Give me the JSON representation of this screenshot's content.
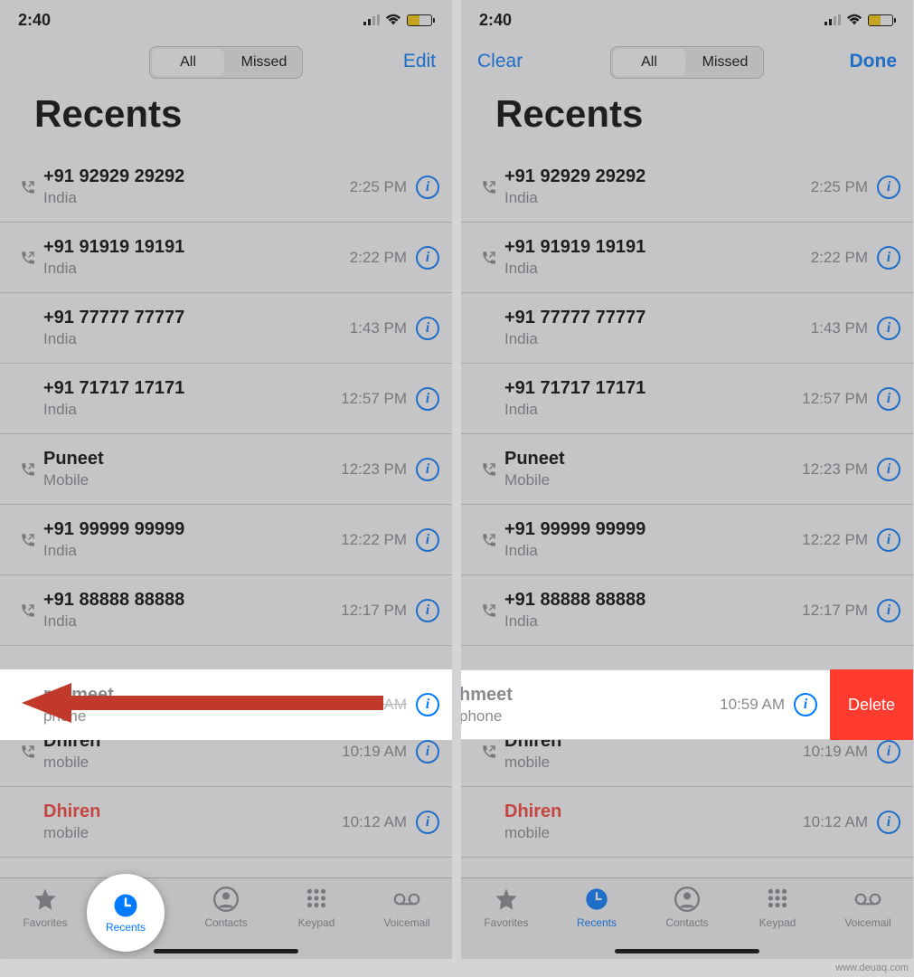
{
  "status": {
    "time": "2:40"
  },
  "left": {
    "nav": {
      "edit": "Edit",
      "seg_all": "All",
      "seg_missed": "Missed"
    },
    "title": "Recents",
    "calls": [
      {
        "name": "+91 92929 29292",
        "sub": "India",
        "time": "2:25 PM",
        "outgoing": true,
        "missed": false
      },
      {
        "name": "+91 91919 19191",
        "sub": "India",
        "time": "2:22 PM",
        "outgoing": true,
        "missed": false
      },
      {
        "name": "+91 77777 77777",
        "sub": "India",
        "time": "1:43 PM",
        "outgoing": false,
        "missed": false
      },
      {
        "name": "+91 71717 17171",
        "sub": "India",
        "time": "12:57 PM",
        "outgoing": false,
        "missed": false
      },
      {
        "name": "Puneet",
        "sub": "Mobile",
        "time": "12:23 PM",
        "outgoing": true,
        "missed": false
      },
      {
        "name": "+91 99999 99999",
        "sub": "India",
        "time": "12:22 PM",
        "outgoing": true,
        "missed": false
      },
      {
        "name": "+91 88888 88888",
        "sub": "India",
        "time": "12:17 PM",
        "outgoing": true,
        "missed": false
      },
      {
        "name": "rshmeet",
        "sub": "phone",
        "time": "10:59 AM",
        "outgoing": false,
        "missed": false
      },
      {
        "name": "Dhiren",
        "sub": "mobile",
        "time": "10:19 AM",
        "outgoing": true,
        "missed": false
      },
      {
        "name": "Dhiren",
        "sub": "mobile",
        "time": "10:12 AM",
        "outgoing": false,
        "missed": true
      }
    ],
    "tabs": {
      "favorites": "Favorites",
      "recents": "Recents",
      "contacts": "Contacts",
      "keypad": "Keypad",
      "voicemail": "Voicemail"
    }
  },
  "right": {
    "nav": {
      "clear": "Clear",
      "done": "Done",
      "seg_all": "All",
      "seg_missed": "Missed"
    },
    "title": "Recents",
    "swipe": {
      "name": "hmeet",
      "sub": "phone",
      "time": "10:59 AM",
      "delete": "Delete"
    },
    "calls": [
      {
        "name": "+91 92929 29292",
        "sub": "India",
        "time": "2:25 PM",
        "outgoing": true,
        "missed": false
      },
      {
        "name": "+91 91919 19191",
        "sub": "India",
        "time": "2:22 PM",
        "outgoing": true,
        "missed": false
      },
      {
        "name": "+91 77777 77777",
        "sub": "India",
        "time": "1:43 PM",
        "outgoing": false,
        "missed": false
      },
      {
        "name": "+91 71717 17171",
        "sub": "India",
        "time": "12:57 PM",
        "outgoing": false,
        "missed": false
      },
      {
        "name": "Puneet",
        "sub": "Mobile",
        "time": "12:23 PM",
        "outgoing": true,
        "missed": false
      },
      {
        "name": "+91 99999 99999",
        "sub": "India",
        "time": "12:22 PM",
        "outgoing": true,
        "missed": false
      },
      {
        "name": "+91 88888 88888",
        "sub": "India",
        "time": "12:17 PM",
        "outgoing": true,
        "missed": false
      },
      {
        "name": "Dhiren",
        "sub": "mobile",
        "time": "10:19 AM",
        "outgoing": true,
        "missed": false
      },
      {
        "name": "Dhiren",
        "sub": "mobile",
        "time": "10:12 AM",
        "outgoing": false,
        "missed": true
      }
    ],
    "tabs": {
      "favorites": "Favorites",
      "recents": "Recents",
      "contacts": "Contacts",
      "keypad": "Keypad",
      "voicemail": "Voicemail"
    }
  },
  "watermark": "www.deuaq.com"
}
